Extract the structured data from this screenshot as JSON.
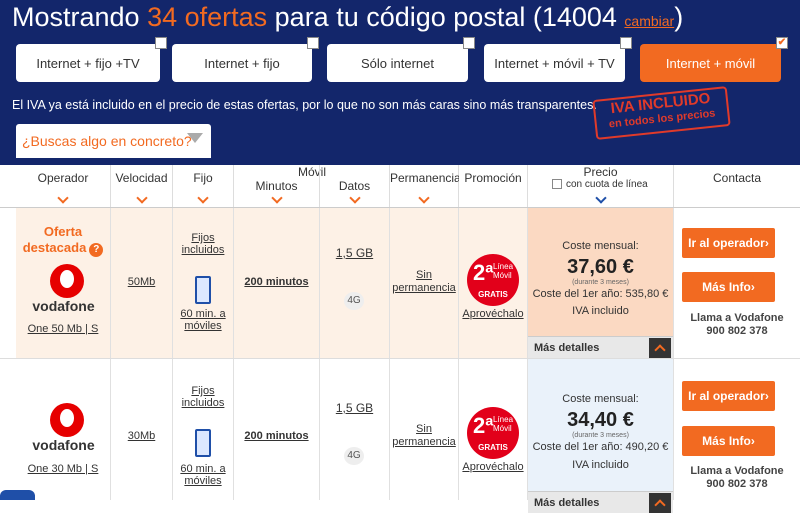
{
  "header": {
    "title_prefix": "Mostrando ",
    "title_count": "34 ofertas",
    "title_suffix": " para tu código postal (14004",
    "title_end": ")",
    "change_link": "cambiar"
  },
  "filters": [
    {
      "label": "Internet + fijo +TV",
      "checked": false
    },
    {
      "label": "Internet + fijo",
      "checked": false
    },
    {
      "label": "Sólo internet",
      "checked": false
    },
    {
      "label": "Internet + móvil + TV",
      "checked": false
    },
    {
      "label": "Internet + móvil",
      "checked": true,
      "mark": "✔"
    }
  ],
  "iva_note": "El IVA ya está incluido en el precio de estas ofertas, por lo que no son más caras sino más transparentes.",
  "iva_stamp": {
    "line1": "IVA INCLUIDO",
    "line2": "en todos los precios"
  },
  "search_label": "¿Buscas algo en concreto?",
  "columns": {
    "operador": "Operador",
    "velocidad": "Velocidad",
    "fijo": "Fijo",
    "movil": "Móvil",
    "minutos": "Minutos",
    "datos": "Datos",
    "permanencia": "Permanencia",
    "promocion": "Promoción",
    "precio": "Precio",
    "cuota": "con cuota de línea",
    "contacta": "Contacta"
  },
  "offers": [
    {
      "featured_1": "Oferta",
      "featured_2": "destacada",
      "featured_q": "?",
      "brand": "vodafone",
      "plan": "One 50 Mb | S",
      "speed": "50Mb",
      "fijo_1": "Fijos",
      "fijo_2": "incluidos",
      "mobile_min_1": "60 min. a",
      "mobile_min_2": "móviles",
      "minutes": "200 minutos",
      "data": "1,5 GB",
      "net": "4G",
      "perm_1": "Sin",
      "perm_2": "permanencia",
      "promo_num": "2ª",
      "promo_t1": "Línea",
      "promo_t2": "Móvil",
      "promo_gratis": "GRATIS",
      "promo_link": "Aprovéchalo",
      "coste_label": "Coste mensual:",
      "price": "37,60 €",
      "duration": "(durante 3 meses)",
      "first_year": "Coste del 1er año:  535,80 €",
      "iva": "IVA incluido",
      "btn_operator": "Ir al operador",
      "btn_info": "Más Info",
      "call_1": "Llama a Vodafone",
      "call_2": "900 802 378",
      "details": "Más detalles"
    },
    {
      "brand": "vodafone",
      "plan": "One 30 Mb | S",
      "speed": "30Mb",
      "fijo_1": "Fijos",
      "fijo_2": "incluidos",
      "mobile_min_1": "60 min. a",
      "mobile_min_2": "móviles",
      "minutes": "200 minutos",
      "data": "1,5 GB",
      "net": "4G",
      "perm_1": "Sin",
      "perm_2": "permanencia",
      "promo_num": "2ª",
      "promo_t1": "Línea",
      "promo_t2": "Móvil",
      "promo_gratis": "GRATIS",
      "promo_link": "Aprovéchalo",
      "coste_label": "Coste mensual:",
      "price": "34,40 €",
      "duration": "(durante 3 meses)",
      "first_year": "Coste del 1er año:  490,20 €",
      "iva": "IVA incluido",
      "btn_operator": "Ir al operador",
      "btn_info": "Más Info",
      "call_1": "Llama a Vodafone",
      "call_2": "900 802 378",
      "details": "Más detalles"
    }
  ],
  "colors": {
    "navy": "#13266b",
    "orange": "#f26a21",
    "red": "#e2001a"
  }
}
